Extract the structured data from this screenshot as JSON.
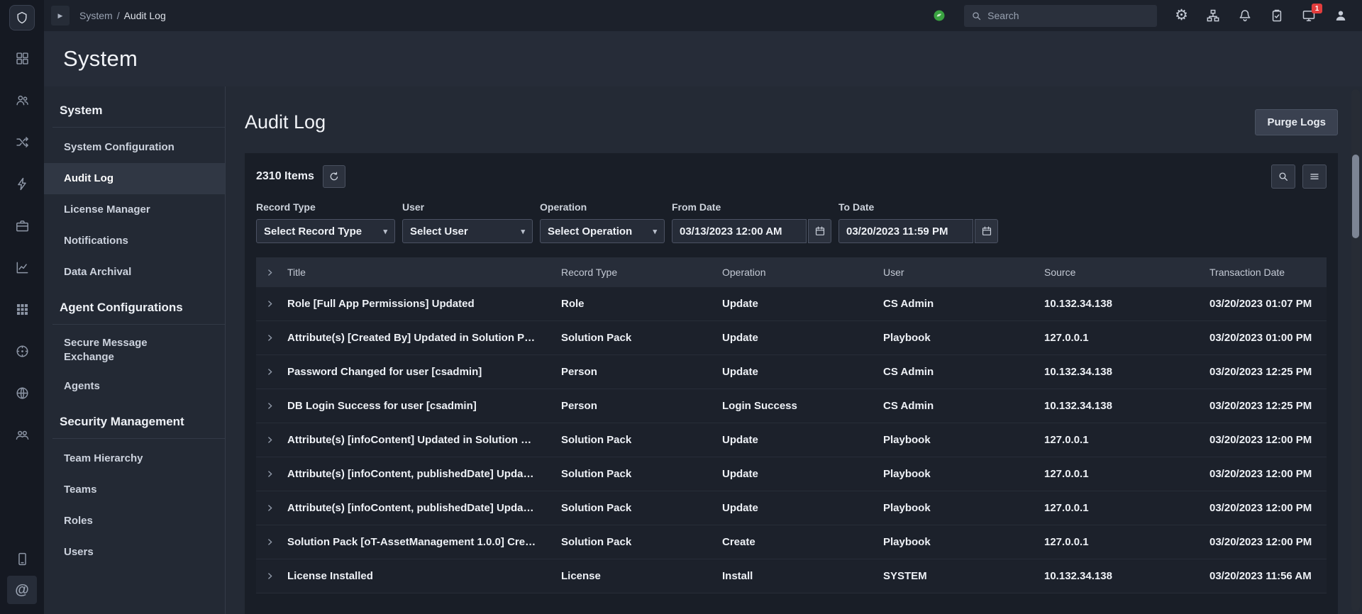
{
  "colors": {
    "status_green": "#3aa341",
    "badge_red": "#e23d3d",
    "active_item_bg": "#303744"
  },
  "glyphs": {
    "caret_down": "▾",
    "collapse_arrow": "▶",
    "gear": "⚙",
    "at_sign": "@"
  },
  "topbar": {
    "breadcrumb": {
      "parent": "System",
      "separator": "/",
      "current": "Audit Log"
    },
    "search": {
      "placeholder": "Search"
    },
    "notification_badge": "1"
  },
  "page": {
    "title": "System"
  },
  "sidebar": {
    "sections": [
      {
        "title": "System",
        "items": [
          {
            "label": "System Configuration"
          },
          {
            "label": "Audit Log",
            "active": true
          },
          {
            "label": "License Manager"
          },
          {
            "label": "Notifications"
          },
          {
            "label": "Data Archival"
          }
        ]
      },
      {
        "title": "Agent Configurations",
        "items": [
          {
            "label": "Secure Message Exchange"
          },
          {
            "label": "Agents"
          }
        ]
      },
      {
        "title": "Security Management",
        "items": [
          {
            "label": "Team Hierarchy"
          },
          {
            "label": "Teams"
          },
          {
            "label": "Roles"
          },
          {
            "label": "Users"
          }
        ]
      }
    ]
  },
  "content": {
    "title": "Audit Log",
    "purge_button": "Purge Logs",
    "items_count": "2310 Items",
    "filters": {
      "record_type": {
        "label": "Record Type",
        "value": "Select Record Type"
      },
      "user": {
        "label": "User",
        "value": "Select User"
      },
      "operation": {
        "label": "Operation",
        "value": "Select Operation"
      },
      "from_date": {
        "label": "From Date",
        "value": "03/13/2023 12:00 AM"
      },
      "to_date": {
        "label": "To Date",
        "value": "03/20/2023 11:59 PM"
      }
    },
    "table": {
      "columns": [
        "Title",
        "Record Type",
        "Operation",
        "User",
        "Source",
        "Transaction Date"
      ],
      "rows": [
        {
          "title": "Role [Full App Permissions] Updated",
          "record_type": "Role",
          "operation": "Update",
          "user": "CS Admin",
          "source": "10.132.34.138",
          "date": "03/20/2023 01:07 PM"
        },
        {
          "title": "Attribute(s) [Created By] Updated in Solution P…",
          "record_type": "Solution Pack",
          "operation": "Update",
          "user": "Playbook",
          "source": "127.0.0.1",
          "date": "03/20/2023 01:00 PM"
        },
        {
          "title": "Password Changed for user [csadmin]",
          "record_type": "Person",
          "operation": "Update",
          "user": "CS Admin",
          "source": "10.132.34.138",
          "date": "03/20/2023 12:25 PM"
        },
        {
          "title": "DB Login Success for user [csadmin]",
          "record_type": "Person",
          "operation": "Login Success",
          "user": "CS Admin",
          "source": "10.132.34.138",
          "date": "03/20/2023 12:25 PM"
        },
        {
          "title": "Attribute(s) [infoContent] Updated in Solution …",
          "record_type": "Solution Pack",
          "operation": "Update",
          "user": "Playbook",
          "source": "127.0.0.1",
          "date": "03/20/2023 12:00 PM"
        },
        {
          "title": "Attribute(s) [infoContent, publishedDate] Upda…",
          "record_type": "Solution Pack",
          "operation": "Update",
          "user": "Playbook",
          "source": "127.0.0.1",
          "date": "03/20/2023 12:00 PM"
        },
        {
          "title": "Attribute(s) [infoContent, publishedDate] Upda…",
          "record_type": "Solution Pack",
          "operation": "Update",
          "user": "Playbook",
          "source": "127.0.0.1",
          "date": "03/20/2023 12:00 PM"
        },
        {
          "title": "Solution Pack [oT-AssetManagement 1.0.0] Cre…",
          "record_type": "Solution Pack",
          "operation": "Create",
          "user": "Playbook",
          "source": "127.0.0.1",
          "date": "03/20/2023 12:00 PM"
        },
        {
          "title": "License Installed",
          "record_type": "License",
          "operation": "Install",
          "user": "SYSTEM",
          "source": "10.132.34.138",
          "date": "03/20/2023 11:56 AM"
        }
      ]
    }
  }
}
